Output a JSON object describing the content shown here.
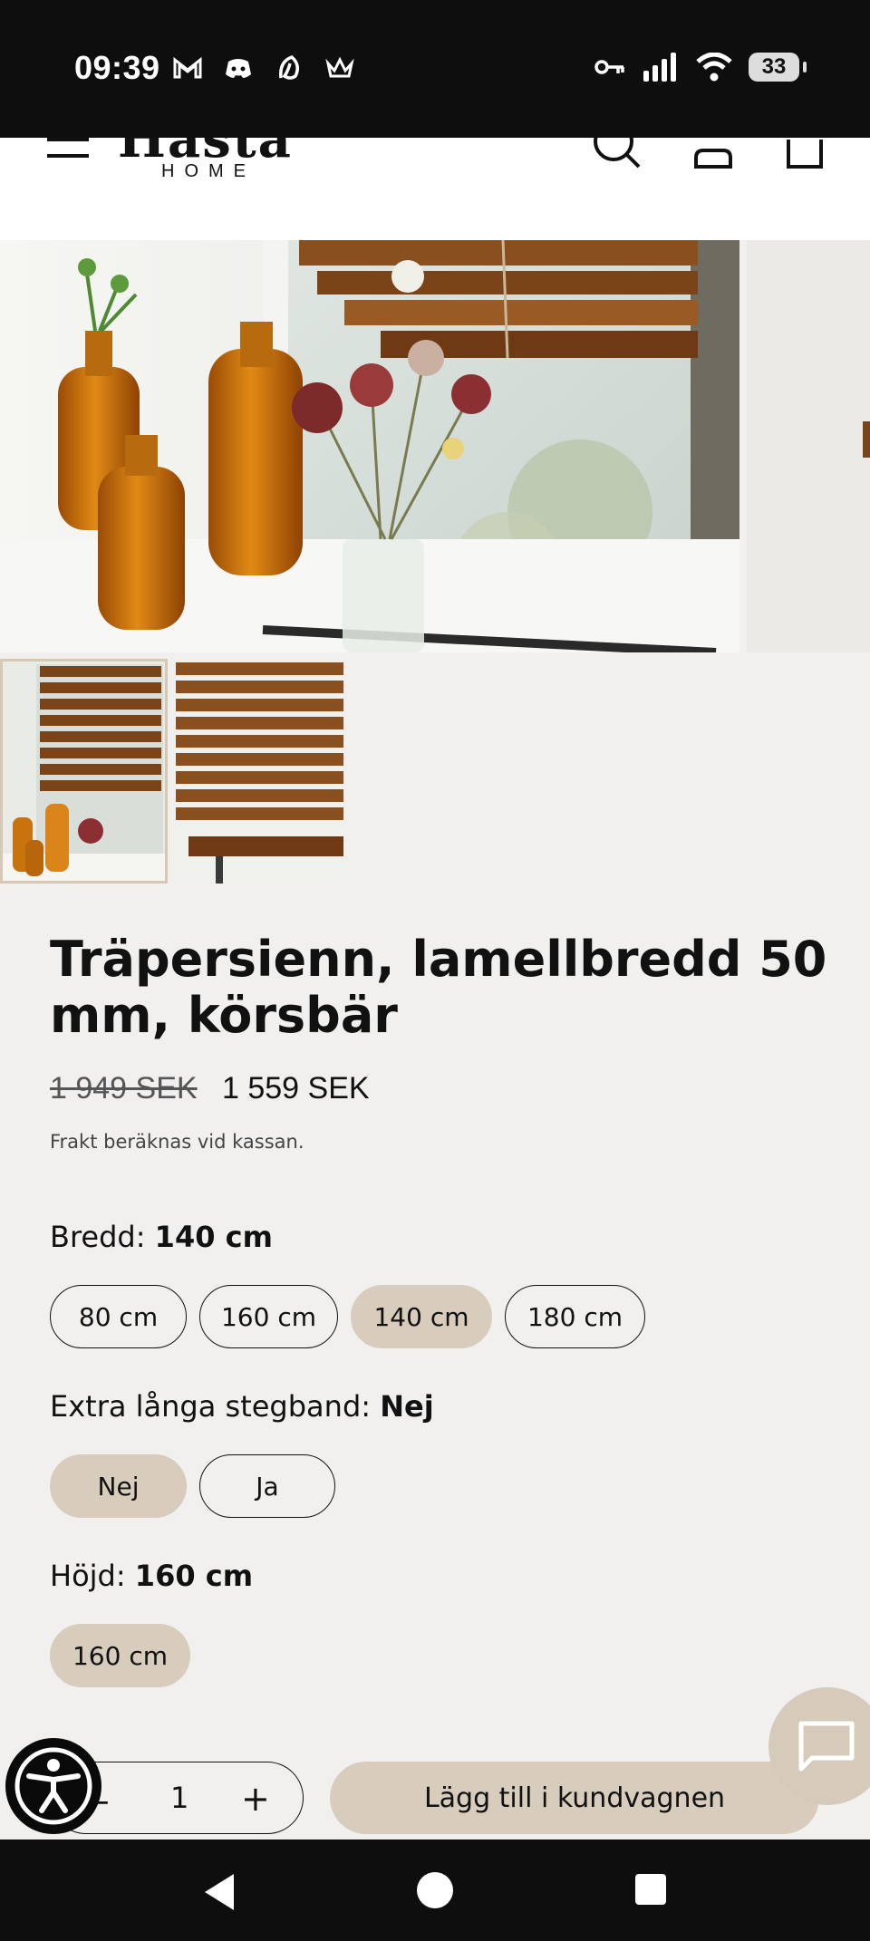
{
  "status_bar": {
    "time": "09:39",
    "left_icons": [
      "gmail-icon",
      "discord-icon",
      "app-icon",
      "crown-icon"
    ],
    "right_icons": [
      "vpn-key-icon",
      "signal-icon",
      "wifi-icon"
    ],
    "battery": "33"
  },
  "header": {
    "logo_text": "Hästa",
    "logo_subtext": "HOME",
    "icons": [
      "menu-icon",
      "search-icon",
      "account-icon",
      "cart-icon"
    ]
  },
  "gallery": {
    "main_image": "Wooden blinds in window with amber bottles and flowers",
    "thumbnails": [
      "thumbnail-1",
      "thumbnail-2"
    ]
  },
  "product": {
    "title": "Träpersienn, lamellbredd 50 mm, körsbär",
    "price_old": "1 949 SEK",
    "price_new": "1 559 SEK",
    "shipping_note": "Frakt beräknas vid kassan."
  },
  "options": {
    "width": {
      "label": "Bredd:",
      "selected": "140 cm",
      "values": [
        "80 cm",
        "160 cm",
        "140 cm",
        "180 cm"
      ]
    },
    "long_cords": {
      "label": "Extra långa stegband:",
      "selected": "Nej",
      "values": [
        "Nej",
        "Ja"
      ]
    },
    "height": {
      "label": "Höjd:",
      "selected": "160 cm",
      "values": [
        "160 cm"
      ]
    }
  },
  "cart": {
    "qty_minus": "−",
    "qty_value": "1",
    "qty_plus": "+",
    "add_to_cart_label": "Lägg till i kundvagnen"
  },
  "colors": {
    "accent": "#d8cdbd",
    "background": "#f1f0ef",
    "text": "#111111"
  }
}
